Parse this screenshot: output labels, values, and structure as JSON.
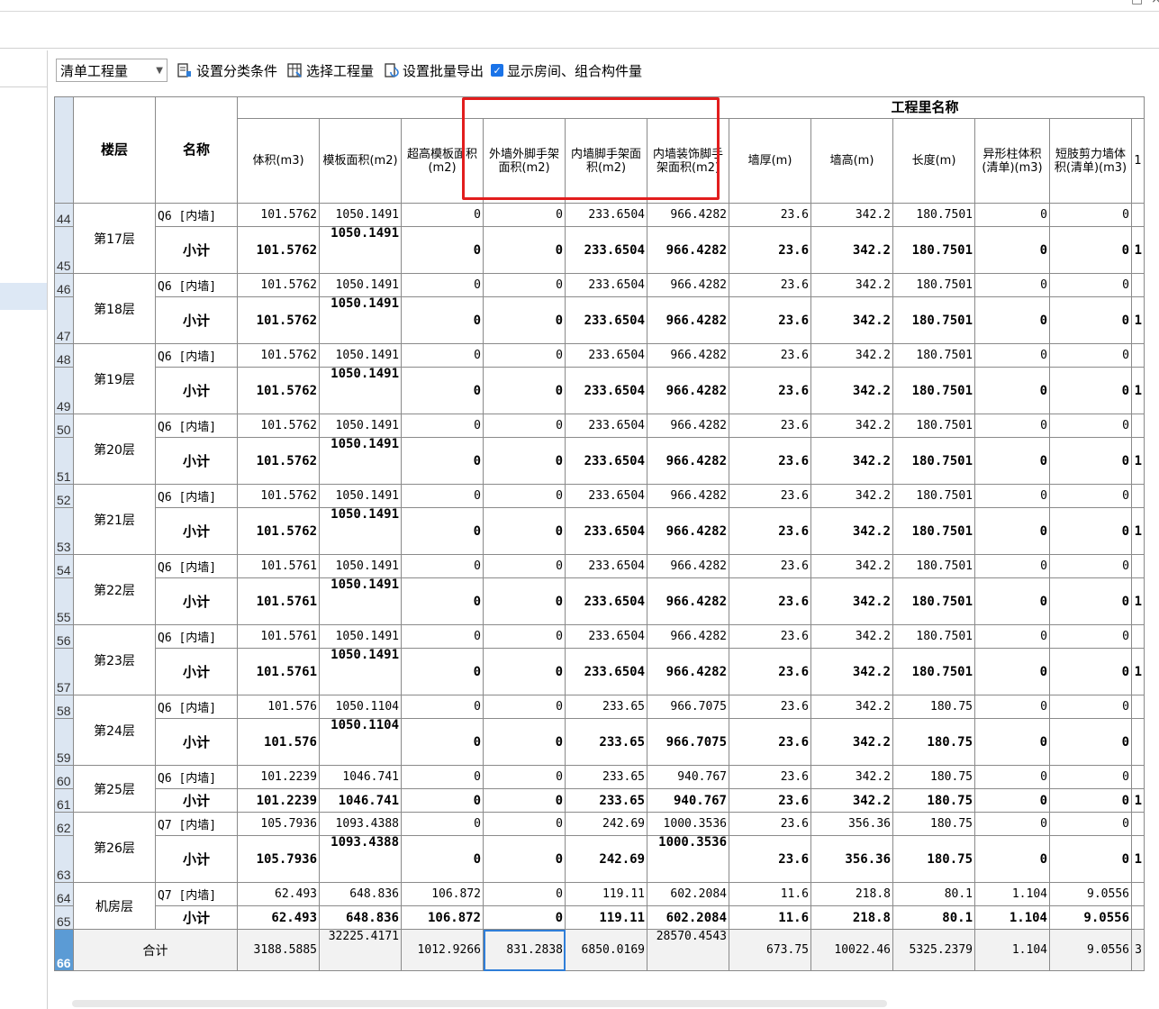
{
  "toolbar": {
    "category_select": "清单工程量",
    "set_conditions": "设置分类条件",
    "select_quantities": "选择工程量",
    "batch_export": "设置批量导出",
    "show_rooms": "显示房间、组合构件量"
  },
  "table": {
    "group_header": "工程里名称",
    "headers": [
      "楼层",
      "名称",
      "体积(m3)",
      "模板面积(m2)",
      "超高模板面积(m2)",
      "外墙外脚手架面积(m2)",
      "内墙脚手架面积(m2)",
      "内墙装饰脚手架面积(m2)",
      "墙厚(m)",
      "墙高(m)",
      "长度(m)",
      "异形柱体积(清单)(m3)",
      "短肢剪力墙体积(清单)(m3)",
      "1"
    ],
    "floors": [
      {
        "floor": "第17层",
        "rows": [
          {
            "rn": "44",
            "name": "Q6 [内墙]",
            "cells": [
              "101.5762",
              "1050.1491",
              "0",
              "0",
              "233.6504",
              "966.4282",
              "23.6",
              "342.2",
              "180.7501",
              "0",
              "0",
              ""
            ]
          },
          {
            "rn": "45",
            "name": "小计",
            "cells": [
              "101.5762",
              "1050.1491",
              "0",
              "0",
              "233.6504",
              "966.4282",
              "23.6",
              "342.2",
              "180.7501",
              "0",
              "0",
              "1"
            ]
          }
        ]
      },
      {
        "floor": "第18层",
        "rows": [
          {
            "rn": "46",
            "name": "Q6 [内墙]",
            "cells": [
              "101.5762",
              "1050.1491",
              "0",
              "0",
              "233.6504",
              "966.4282",
              "23.6",
              "342.2",
              "180.7501",
              "0",
              "0",
              ""
            ]
          },
          {
            "rn": "47",
            "name": "小计",
            "cells": [
              "101.5762",
              "1050.1491",
              "0",
              "0",
              "233.6504",
              "966.4282",
              "23.6",
              "342.2",
              "180.7501",
              "0",
              "0",
              "1"
            ]
          }
        ]
      },
      {
        "floor": "第19层",
        "rows": [
          {
            "rn": "48",
            "name": "Q6 [内墙]",
            "cells": [
              "101.5762",
              "1050.1491",
              "0",
              "0",
              "233.6504",
              "966.4282",
              "23.6",
              "342.2",
              "180.7501",
              "0",
              "0",
              ""
            ]
          },
          {
            "rn": "49",
            "name": "小计",
            "cells": [
              "101.5762",
              "1050.1491",
              "0",
              "0",
              "233.6504",
              "966.4282",
              "23.6",
              "342.2",
              "180.7501",
              "0",
              "0",
              "1"
            ]
          }
        ]
      },
      {
        "floor": "第20层",
        "rows": [
          {
            "rn": "50",
            "name": "Q6 [内墙]",
            "cells": [
              "101.5762",
              "1050.1491",
              "0",
              "0",
              "233.6504",
              "966.4282",
              "23.6",
              "342.2",
              "180.7501",
              "0",
              "0",
              ""
            ]
          },
          {
            "rn": "51",
            "name": "小计",
            "cells": [
              "101.5762",
              "1050.1491",
              "0",
              "0",
              "233.6504",
              "966.4282",
              "23.6",
              "342.2",
              "180.7501",
              "0",
              "0",
              "1"
            ]
          }
        ]
      },
      {
        "floor": "第21层",
        "rows": [
          {
            "rn": "52",
            "name": "Q6 [内墙]",
            "cells": [
              "101.5762",
              "1050.1491",
              "0",
              "0",
              "233.6504",
              "966.4282",
              "23.6",
              "342.2",
              "180.7501",
              "0",
              "0",
              ""
            ]
          },
          {
            "rn": "53",
            "name": "小计",
            "cells": [
              "101.5762",
              "1050.1491",
              "0",
              "0",
              "233.6504",
              "966.4282",
              "23.6",
              "342.2",
              "180.7501",
              "0",
              "0",
              "1"
            ]
          }
        ]
      },
      {
        "floor": "第22层",
        "rows": [
          {
            "rn": "54",
            "name": "Q6 [内墙]",
            "cells": [
              "101.5761",
              "1050.1491",
              "0",
              "0",
              "233.6504",
              "966.4282",
              "23.6",
              "342.2",
              "180.7501",
              "0",
              "0",
              ""
            ]
          },
          {
            "rn": "55",
            "name": "小计",
            "cells": [
              "101.5761",
              "1050.1491",
              "0",
              "0",
              "233.6504",
              "966.4282",
              "23.6",
              "342.2",
              "180.7501",
              "0",
              "0",
              "1"
            ]
          }
        ]
      },
      {
        "floor": "第23层",
        "rows": [
          {
            "rn": "56",
            "name": "Q6 [内墙]",
            "cells": [
              "101.5761",
              "1050.1491",
              "0",
              "0",
              "233.6504",
              "966.4282",
              "23.6",
              "342.2",
              "180.7501",
              "0",
              "0",
              ""
            ]
          },
          {
            "rn": "57",
            "name": "小计",
            "cells": [
              "101.5761",
              "1050.1491",
              "0",
              "0",
              "233.6504",
              "966.4282",
              "23.6",
              "342.2",
              "180.7501",
              "0",
              "0",
              "1"
            ]
          }
        ]
      },
      {
        "floor": "第24层",
        "rows": [
          {
            "rn": "58",
            "name": "Q6 [内墙]",
            "cells": [
              "101.576",
              "1050.1104",
              "0",
              "0",
              "233.65",
              "966.7075",
              "23.6",
              "342.2",
              "180.75",
              "0",
              "0",
              ""
            ]
          },
          {
            "rn": "59",
            "name": "小计",
            "cells": [
              "101.576",
              "1050.1104",
              "0",
              "0",
              "233.65",
              "966.7075",
              "23.6",
              "342.2",
              "180.75",
              "0",
              "0",
              ""
            ]
          }
        ]
      },
      {
        "floor": "第25层",
        "rows": [
          {
            "rn": "60",
            "name": "Q6 [内墙]",
            "cells": [
              "101.2239",
              "1046.741",
              "0",
              "0",
              "233.65",
              "940.767",
              "23.6",
              "342.2",
              "180.75",
              "0",
              "0",
              ""
            ]
          },
          {
            "rn": "61",
            "name": "小计",
            "cells": [
              "101.2239",
              "1046.741",
              "0",
              "0",
              "233.65",
              "940.767",
              "23.6",
              "342.2",
              "180.75",
              "0",
              "0",
              "1"
            ]
          }
        ]
      },
      {
        "floor": "第26层",
        "rows": [
          {
            "rn": "62",
            "name": "Q7 [内墙]",
            "cells": [
              "105.7936",
              "1093.4388",
              "0",
              "0",
              "242.69",
              "1000.3536",
              "23.6",
              "356.36",
              "180.75",
              "0",
              "0",
              ""
            ]
          },
          {
            "rn": "63",
            "name": "小计",
            "cells": [
              "105.7936",
              "1093.4388",
              "0",
              "0",
              "242.69",
              "1000.3536",
              "23.6",
              "356.36",
              "180.75",
              "0",
              "0",
              "1"
            ]
          }
        ]
      },
      {
        "floor": "机房层",
        "rows": [
          {
            "rn": "64",
            "name": "Q7 [内墙]",
            "cells": [
              "62.493",
              "648.836",
              "106.872",
              "0",
              "119.11",
              "602.2084",
              "11.6",
              "218.8",
              "80.1",
              "1.104",
              "9.0556",
              ""
            ]
          },
          {
            "rn": "65",
            "name": "小计",
            "cells": [
              "62.493",
              "648.836",
              "106.872",
              "0",
              "119.11",
              "602.2084",
              "11.6",
              "218.8",
              "80.1",
              "1.104",
              "9.0556",
              ""
            ]
          }
        ]
      }
    ],
    "total": {
      "rn": "66",
      "label": "合计",
      "cells": [
        "3188.5885",
        "32225.4171",
        "1012.9266",
        "831.2838",
        "6850.0169",
        "28570.4543",
        "673.75",
        "10022.46",
        "5325.2379",
        "1.104",
        "9.0556",
        "3"
      ]
    }
  }
}
